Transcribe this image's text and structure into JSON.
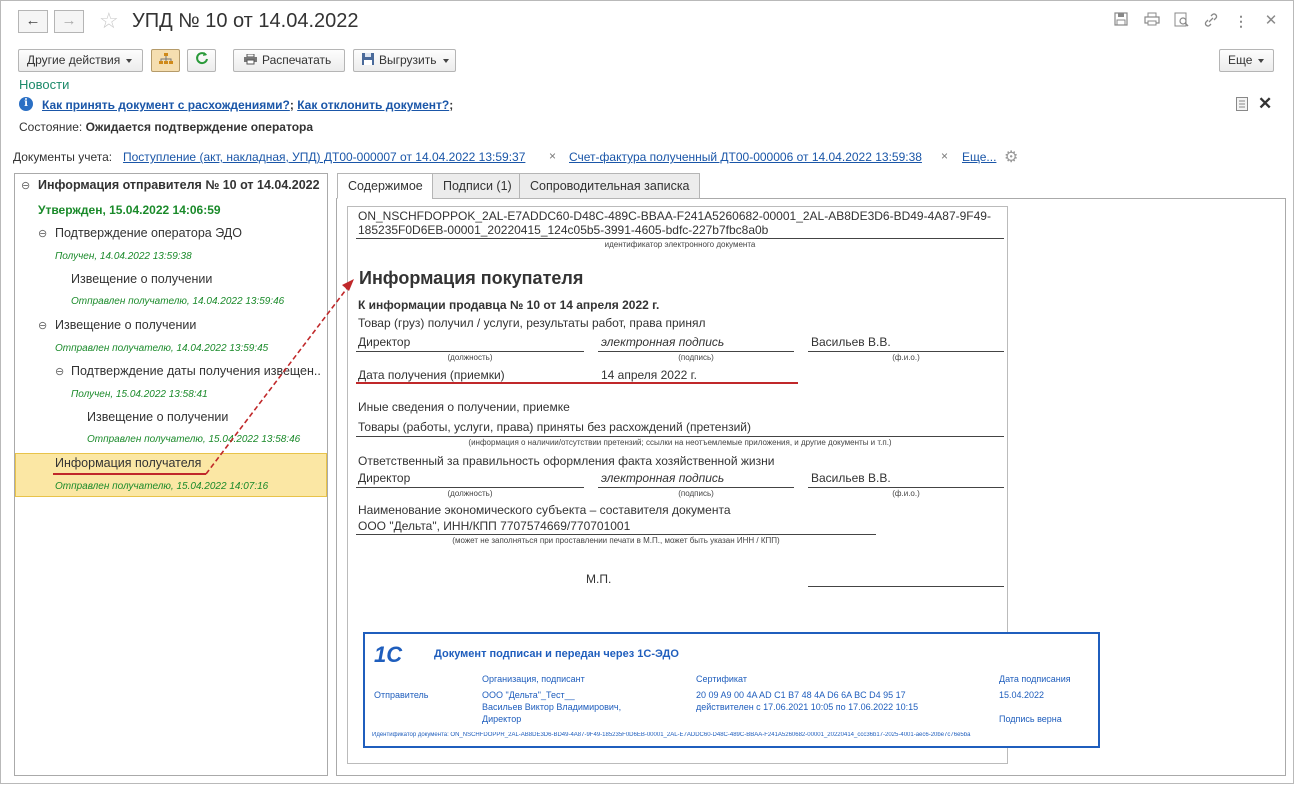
{
  "window": {
    "title": "УПД № 10 от 14.04.2022"
  },
  "nav": {
    "back_icon": "arrow-left-icon",
    "forward_icon": "arrow-right-icon",
    "favorite_icon": "star-icon"
  },
  "title_icons": [
    "save-icon",
    "print-icon",
    "preview-icon",
    "link-icon",
    "more-icon",
    "close-icon"
  ],
  "toolbar": {
    "other_actions": "Другие действия",
    "print": "Распечатать",
    "export": "Выгрузить",
    "more": "Еще"
  },
  "news": "Новости",
  "help": {
    "accept_link": "Как принять документ с расхождениями?",
    "sep": ";",
    "reject_link": "Как отклонить документ?",
    "end": ";"
  },
  "status": {
    "label": "Состояние:",
    "value": "Ожидается подтверждение оператора"
  },
  "accounting": {
    "label": "Документы учета:",
    "doc1": "Поступление (акт, накладная, УПД) ДТ00-000007 от 14.04.2022 13:59:37",
    "doc2": "Счет-фактура полученный ДТ00-000006 от 14.04.2022 13:59:38",
    "more": "Еще..."
  },
  "tree": {
    "root": "Информация отправителя № 10 от 14.04.2022",
    "approved": "Утвержден, 15.04.2022 14:06:59",
    "items": [
      {
        "label": "Подтверждение оператора ЭДО",
        "status": "Получен, 14.04.2022 13:59:38"
      },
      {
        "label": "Извещение о получении",
        "status": "Отправлен получателю, 14.04.2022 13:59:46"
      },
      {
        "label": "Извещение о получении",
        "status": "Отправлен получателю, 14.04.2022 13:59:45"
      },
      {
        "label": "Подтверждение даты получения извещен...",
        "status": "Получен, 15.04.2022 13:58:41"
      },
      {
        "label": "Извещение о получении",
        "status": "Отправлен получателю, 15.04.2022 13:58:46"
      },
      {
        "label": "Информация получателя",
        "status": "Отправлен получателю, 15.04.2022 14:07:16"
      }
    ]
  },
  "tabs": [
    "Содержимое",
    "Подписи (1)",
    "Сопроводительная записка"
  ],
  "document": {
    "id_line1": "ON_NSCHFDOPPOK_2AL-E7ADDC60-D48C-489C-BBAA-F241A5260682-00001_2AL-AB8DE3D6-BD49-4A87-9F49-",
    "id_line2": "185235F0D6EB-00001_20220415_124c05b5-3991-4605-bdfc-227b7fbc8a0b",
    "id_caption": "идентификатор электронного документа",
    "heading": "Информация покупателя",
    "subheading": "К информации продавца № 10 от 14 апреля 2022 г.",
    "received_line": "Товар (груз) получил / услуги, результаты работ, права принял",
    "position1": "Директор",
    "signature1": "электронная подпись",
    "name1": "Васильев В.В.",
    "cap_position": "(должность)",
    "cap_signature": "(подпись)",
    "cap_name": "(ф.и.о.)",
    "date_label": "Дата получения (приемки)",
    "date_value": "14 апреля 2022 г.",
    "other_info": "Иные сведения о получении, приемке",
    "no_claims": "Товары (работы, услуги, права) приняты без расхождений (претензий)",
    "claims_caption": "(информация о наличии/отсутствии претензий; ссылки на неотъемлемые приложения, и другие документы и т.п.)",
    "responsible": "Ответственный за правильность оформления факта хозяйственной жизни",
    "position2": "Директор",
    "signature2": "электронная подпись",
    "name2": "Васильев В.В.",
    "entity_label": "Наименование экономического субъекта – составителя документа",
    "entity_value": "ООО \"Дельта\", ИНН/КПП 7707574669/770701001",
    "entity_caption": "(может не заполняться при проставлении печати в М.П., может быть указан ИНН / КПП)",
    "mp": "М.П."
  },
  "stamp": {
    "logo": "1С",
    "title": "Документ подписан и передан через 1С-ЭДО",
    "col_org": "Организация, подписант",
    "col_cert": "Сертификат",
    "col_date": "Дата подписания",
    "role": "Отправитель",
    "org": "ООО \"Дельта\"_Тест__",
    "signer": "Васильев Виктор Владимирович,",
    "signer_pos": "Директор",
    "cert": "20 09 A9 00 4A AD C1 B7 48 4A D6 6A BC D4 95 17",
    "cert_valid": "действителен с 17.06.2021 10:05 по 17.06.2022 10:15",
    "sign_date": "15.04.2022",
    "sign_ok": "Подпись верна",
    "doc_id": "Идентификатор документа: ON_NSCHFDOPPR_2AL-AB8DE3D6-BD49-4A87-9F49-185235F0D6EB-00001_2AL-E7ADDC60-D48C-489C-BBAA-F241A5260682-00001_20220414_ccc36b17-2025-4001-aec6-20be7c76e5ba"
  }
}
